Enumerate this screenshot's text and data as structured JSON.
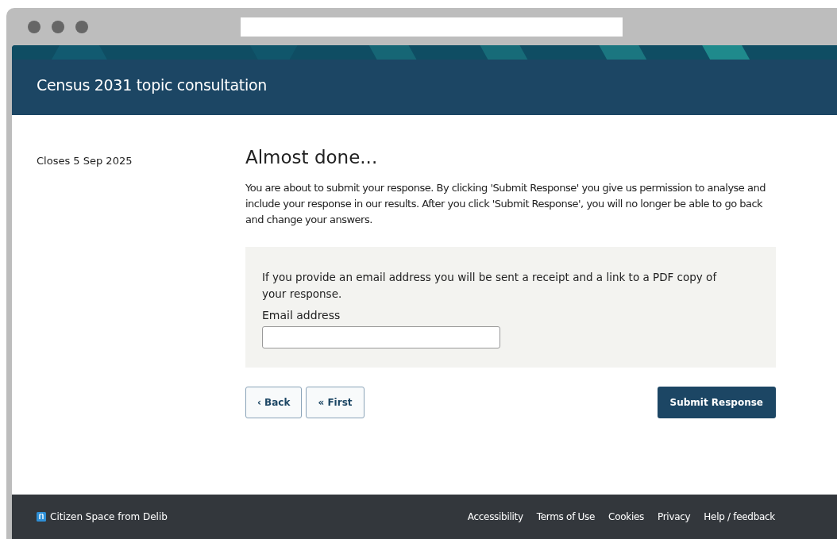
{
  "header": {
    "title": "Census 2031 topic consultation"
  },
  "sidebar": {
    "closes": "Closes 5 Sep 2025"
  },
  "main": {
    "heading": "Almost done...",
    "intro": "You are about to submit your response. By clicking 'Submit Response' you give us permission to analyse and include your response in our results. After you click 'Submit Response', you will no longer be able to go back and change your answers.",
    "email_panel": {
      "text": "If you provide an email address you will be sent a receipt and a link to a PDF copy of your response.",
      "label": "Email address"
    },
    "buttons": [
      {
        "label": "‹ Back",
        "kind": "secondary"
      },
      {
        "label": "« First",
        "kind": "secondary"
      },
      {
        "label": "Submit Response",
        "kind": "primary"
      }
    ]
  },
  "footer": {
    "brand": "Citizen Space from Delib",
    "links": [
      "Accessibility",
      "Terms of Use",
      "Cookies",
      "Privacy",
      "Help / feedback"
    ]
  }
}
